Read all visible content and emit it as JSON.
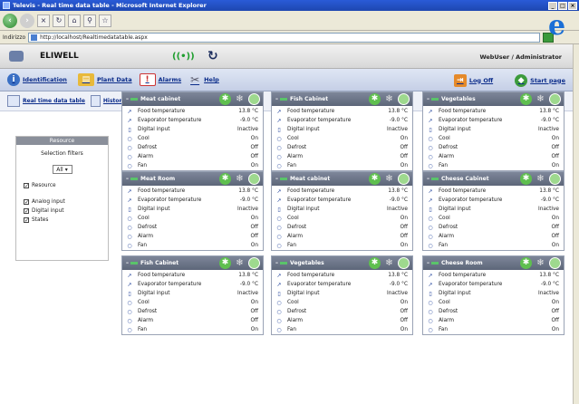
{
  "browser": {
    "title": "Televis - Real time data table - Microsoft Internet Explorer",
    "address_label": "Indirizzo",
    "address": "http://localhost/Realtimedatatable.aspx"
  },
  "app": {
    "brand": "ELIWELL",
    "user": "WebUser / Administrator",
    "menu": [
      {
        "label": "Identification",
        "icon": "info-icon"
      },
      {
        "label": "Plant Data",
        "icon": "folder-icon"
      },
      {
        "label": "Alarms",
        "icon": "alarm-icon"
      },
      {
        "label": "Help",
        "icon": "tools-icon"
      }
    ],
    "logoff": "Log Off",
    "startpage": "Start page",
    "submenu": [
      {
        "label": "Real time data table",
        "icon": "table-icon"
      },
      {
        "label": "Historical data table",
        "icon": "document-icon"
      }
    ]
  },
  "sidebar": {
    "header": "Resource",
    "title": "Selection filters",
    "select_value": "All",
    "checks": [
      {
        "label": "Resource",
        "checked": true
      },
      {
        "label": "Analog input",
        "checked": true
      },
      {
        "label": "Digital input",
        "checked": true
      },
      {
        "label": "States",
        "checked": true
      }
    ]
  },
  "panels": [
    {
      "title": "Meat cabinet",
      "rows": [
        {
          "label": "Food temperature",
          "value": "13.8 °C"
        },
        {
          "label": "Evaporator temperature",
          "value": "-9.0 °C"
        },
        {
          "label": "Digital input",
          "value": "Inactive"
        },
        {
          "label": "Cool",
          "value": "On"
        },
        {
          "label": "Defrost",
          "value": "Off"
        },
        {
          "label": "Alarm",
          "value": "Off"
        },
        {
          "label": "Fan",
          "value": "On"
        }
      ]
    },
    {
      "title": "Fish Cabinet",
      "rows": [
        {
          "label": "Food temperature",
          "value": "13.8 °C"
        },
        {
          "label": "Evaporator temperature",
          "value": "-9.0 °C"
        },
        {
          "label": "Digital input",
          "value": "Inactive"
        },
        {
          "label": "Cool",
          "value": "On"
        },
        {
          "label": "Defrost",
          "value": "Off"
        },
        {
          "label": "Alarm",
          "value": "Off"
        },
        {
          "label": "Fan",
          "value": "On"
        }
      ]
    },
    {
      "title": "Vegetables",
      "rows": [
        {
          "label": "Food temperature",
          "value": "13.8 °C"
        },
        {
          "label": "Evaporator temperature",
          "value": "-9.0 °C"
        },
        {
          "label": "Digital input",
          "value": "Inactive"
        },
        {
          "label": "Cool",
          "value": "On"
        },
        {
          "label": "Defrost",
          "value": "Off"
        },
        {
          "label": "Alarm",
          "value": "Off"
        },
        {
          "label": "Fan",
          "value": "On"
        }
      ]
    },
    {
      "title": "Meat Room",
      "rows": [
        {
          "label": "Food temperature",
          "value": "13.8 °C"
        },
        {
          "label": "Evaporator temperature",
          "value": "-9.0 °C"
        },
        {
          "label": "Digital input",
          "value": "Inactive"
        },
        {
          "label": "Cool",
          "value": "On"
        },
        {
          "label": "Defrost",
          "value": "Off"
        },
        {
          "label": "Alarm",
          "value": "Off"
        },
        {
          "label": "Fan",
          "value": "On"
        }
      ]
    },
    {
      "title": "Meat cabinet",
      "rows": [
        {
          "label": "Food temperature",
          "value": "13.8 °C"
        },
        {
          "label": "Evaporator temperature",
          "value": "-9.0 °C"
        },
        {
          "label": "Digital input",
          "value": "Inactive"
        },
        {
          "label": "Cool",
          "value": "On"
        },
        {
          "label": "Defrost",
          "value": "Off"
        },
        {
          "label": "Alarm",
          "value": "Off"
        },
        {
          "label": "Fan",
          "value": "On"
        }
      ]
    },
    {
      "title": "Cheese Cabinet",
      "rows": [
        {
          "label": "Food temperature",
          "value": "13.8 °C"
        },
        {
          "label": "Evaporator temperature",
          "value": "-9.0 °C"
        },
        {
          "label": "Digital input",
          "value": "Inactive"
        },
        {
          "label": "Cool",
          "value": "On"
        },
        {
          "label": "Defrost",
          "value": "Off"
        },
        {
          "label": "Alarm",
          "value": "Off"
        },
        {
          "label": "Fan",
          "value": "On"
        }
      ]
    },
    {
      "title": "Fish Cabinet",
      "rows": [
        {
          "label": "Food temperature",
          "value": "13.8 °C"
        },
        {
          "label": "Evaporator temperature",
          "value": "-9.0 °C"
        },
        {
          "label": "Digital input",
          "value": "Inactive"
        },
        {
          "label": "Cool",
          "value": "On"
        },
        {
          "label": "Defrost",
          "value": "Off"
        },
        {
          "label": "Alarm",
          "value": "Off"
        },
        {
          "label": "Fan",
          "value": "On"
        }
      ]
    },
    {
      "title": "Vegetables",
      "rows": [
        {
          "label": "Food temperature",
          "value": "13.8 °C"
        },
        {
          "label": "Evaporator temperature",
          "value": "-9.0 °C"
        },
        {
          "label": "Digital input",
          "value": "Inactive"
        },
        {
          "label": "Cool",
          "value": "On"
        },
        {
          "label": "Defrost",
          "value": "Off"
        },
        {
          "label": "Alarm",
          "value": "Off"
        },
        {
          "label": "Fan",
          "value": "On"
        }
      ]
    },
    {
      "title": "Cheese Room",
      "rows": [
        {
          "label": "Food temperature",
          "value": "13.8 °C"
        },
        {
          "label": "Evaporator temperature",
          "value": "-9.0 °C"
        },
        {
          "label": "Digital input",
          "value": "Inactive"
        },
        {
          "label": "Cool",
          "value": "On"
        },
        {
          "label": "Defrost",
          "value": "Off"
        },
        {
          "label": "Alarm",
          "value": "Off"
        },
        {
          "label": "Fan",
          "value": "On"
        }
      ]
    }
  ]
}
